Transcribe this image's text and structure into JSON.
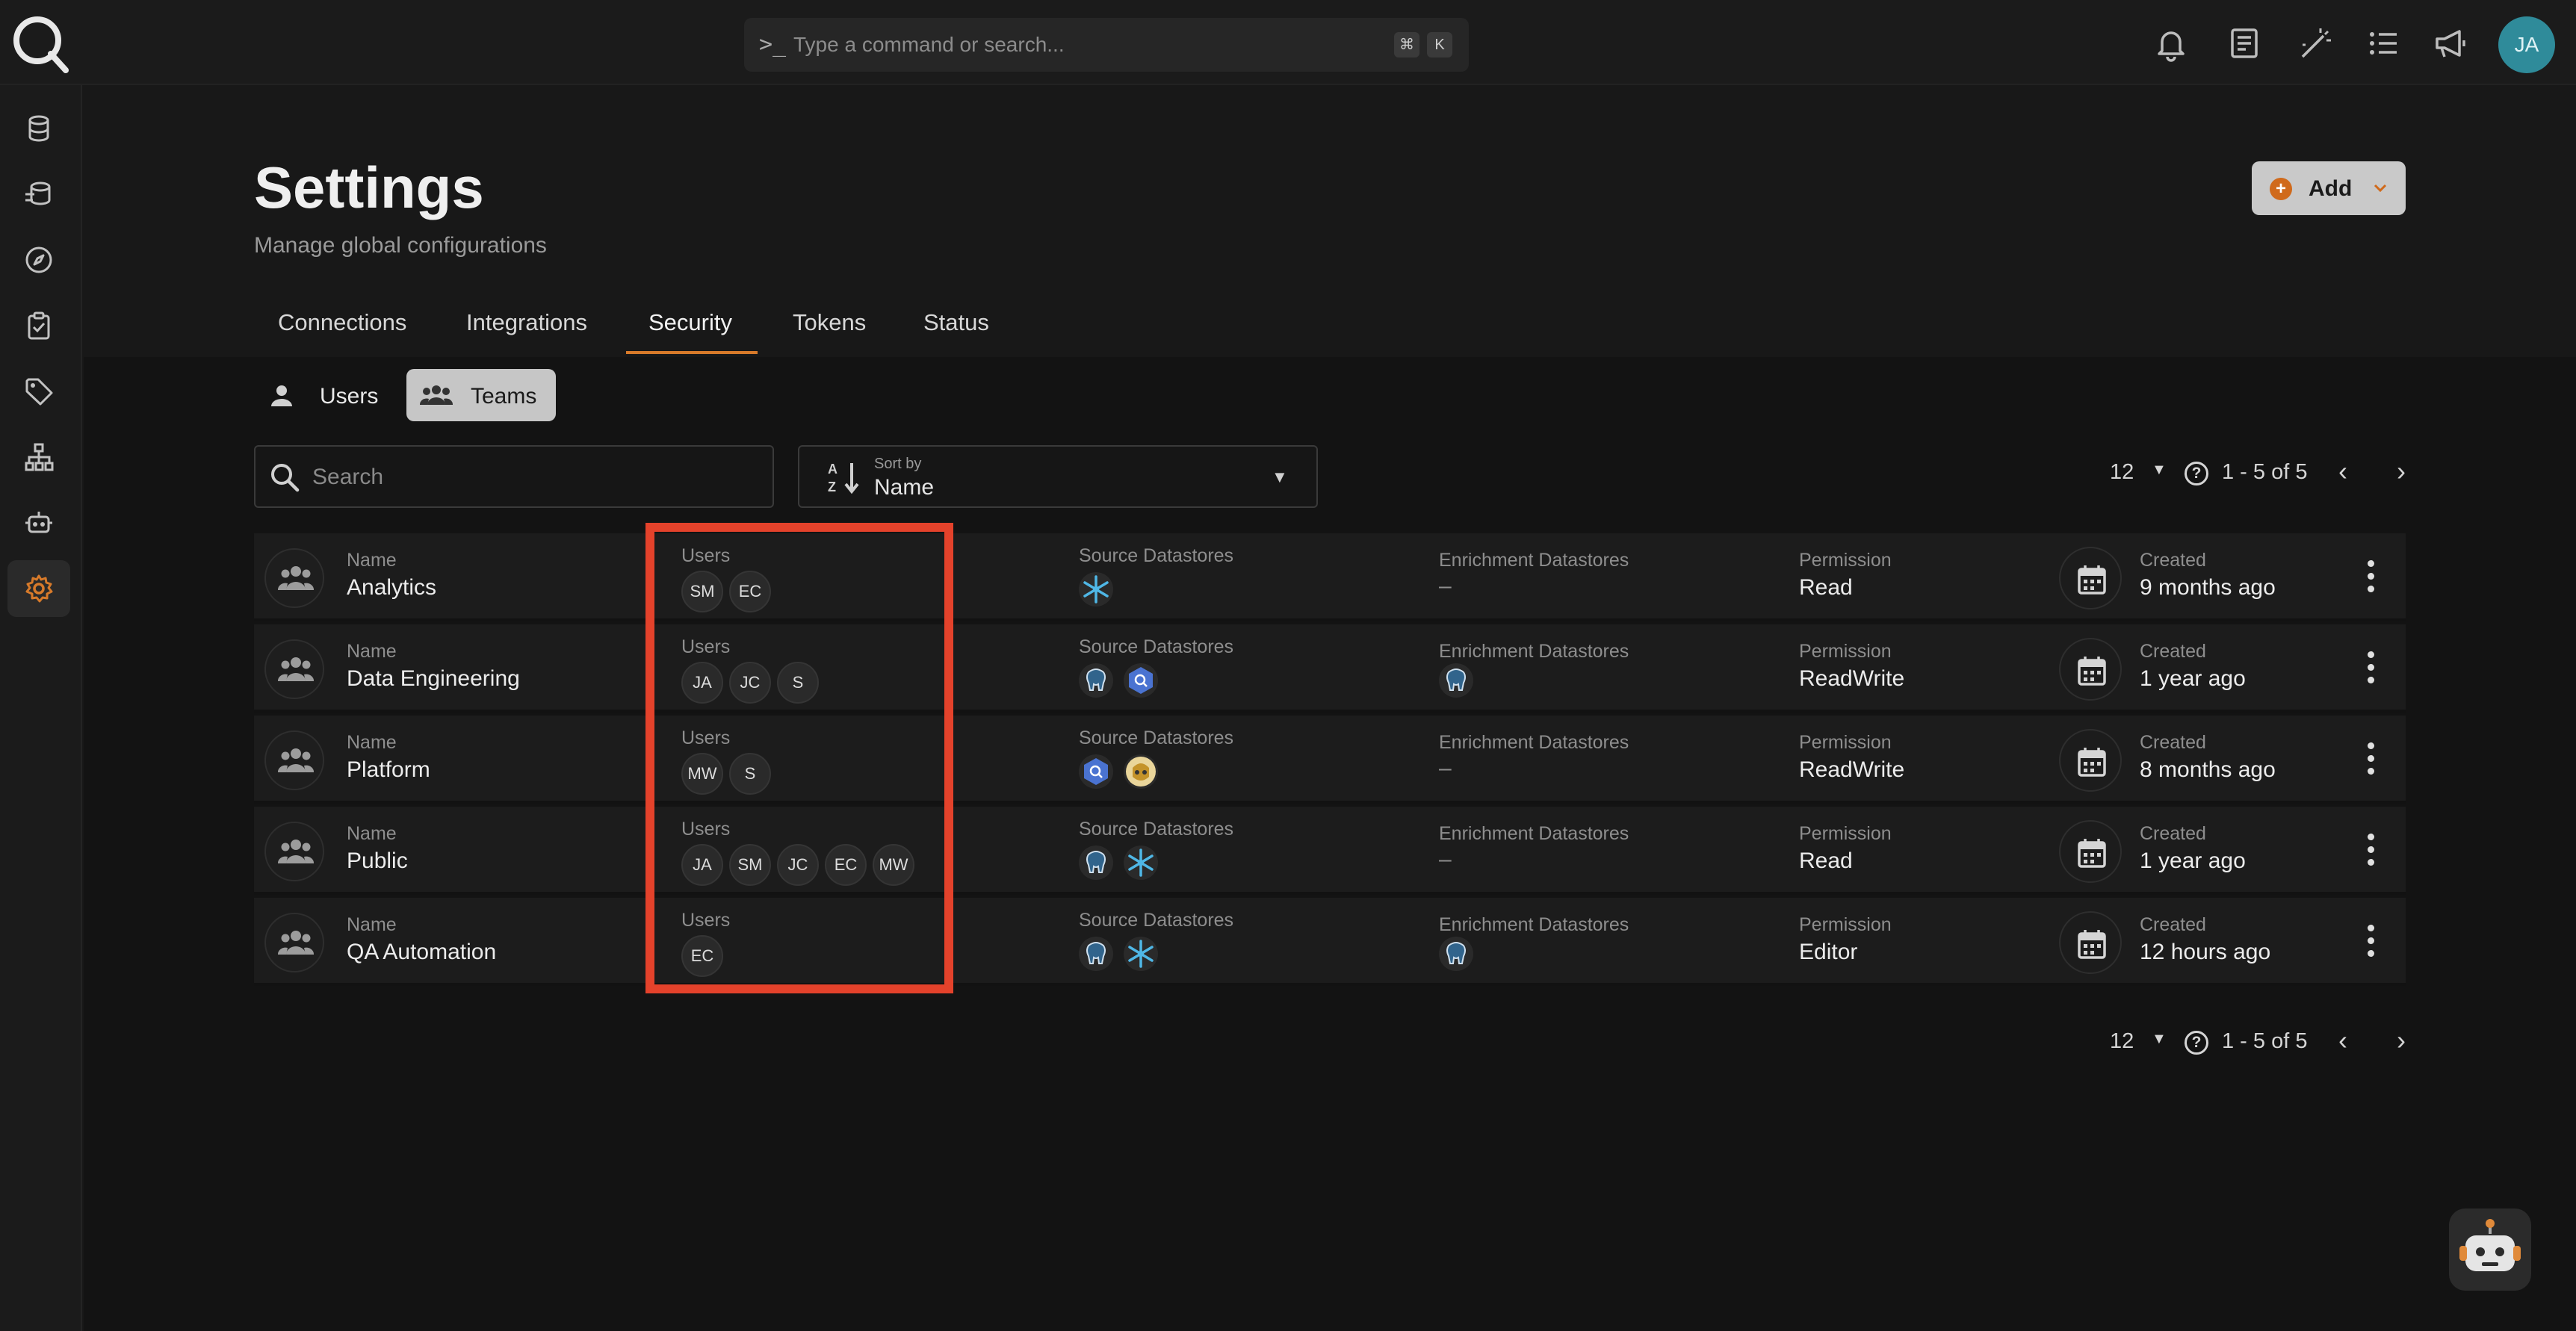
{
  "topbar": {
    "command_prompt": ">_",
    "search_placeholder": "Type a command or search...",
    "shortcut_keys": [
      "⌘",
      "K"
    ],
    "avatar_initials": "JA"
  },
  "sidenav": {
    "items": [
      "datastores-icon",
      "catalog-icon",
      "explore-icon",
      "checks-icon",
      "tags-icon",
      "flows-icon",
      "agents-icon",
      "settings-icon"
    ],
    "active": "settings-icon"
  },
  "header": {
    "title": "Settings",
    "subtitle": "Manage global configurations",
    "add_label": "Add"
  },
  "tabs": [
    "Connections",
    "Integrations",
    "Security",
    "Tokens",
    "Status"
  ],
  "active_tab": "Security",
  "subtoggle": {
    "users": "Users",
    "teams": "Teams",
    "active": "Teams"
  },
  "filters": {
    "search_placeholder": "Search",
    "sort_caption": "Sort by",
    "sort_value": "Name"
  },
  "pagination": {
    "page_size": "12",
    "range": "1 - 5 of 5"
  },
  "columns": {
    "name": "Name",
    "users": "Users",
    "source": "Source Datastores",
    "enrichment": "Enrichment Datastores",
    "permission": "Permission",
    "created": "Created"
  },
  "teams": [
    {
      "name": "Analytics",
      "users": [
        "SM",
        "EC"
      ],
      "source": [
        "snowflake"
      ],
      "enrichment": "–",
      "permission": "Read",
      "created": "9 months ago"
    },
    {
      "name": "Data Engineering",
      "users": [
        "JA",
        "JC",
        "S"
      ],
      "source": [
        "postgres",
        "bigquery"
      ],
      "enrichment": [
        "postgres"
      ],
      "permission": "ReadWrite",
      "created": "1 year ago"
    },
    {
      "name": "Platform",
      "users": [
        "MW",
        "S"
      ],
      "source": [
        "bigquery",
        "hive"
      ],
      "enrichment": "–",
      "permission": "ReadWrite",
      "created": "8 months ago"
    },
    {
      "name": "Public",
      "users": [
        "JA",
        "SM",
        "JC",
        "EC",
        "MW"
      ],
      "source": [
        "postgres",
        "snowflake"
      ],
      "enrichment": "–",
      "permission": "Read",
      "created": "1 year ago"
    },
    {
      "name": "QA Automation",
      "users": [
        "EC"
      ],
      "source": [
        "postgres",
        "snowflake"
      ],
      "enrichment": [
        "postgres"
      ],
      "permission": "Editor",
      "created": "12 hours ago"
    }
  ],
  "colors": {
    "accent": "#d77a2a",
    "highlight": "#e4422b",
    "avatar": "#2f8b9a"
  }
}
